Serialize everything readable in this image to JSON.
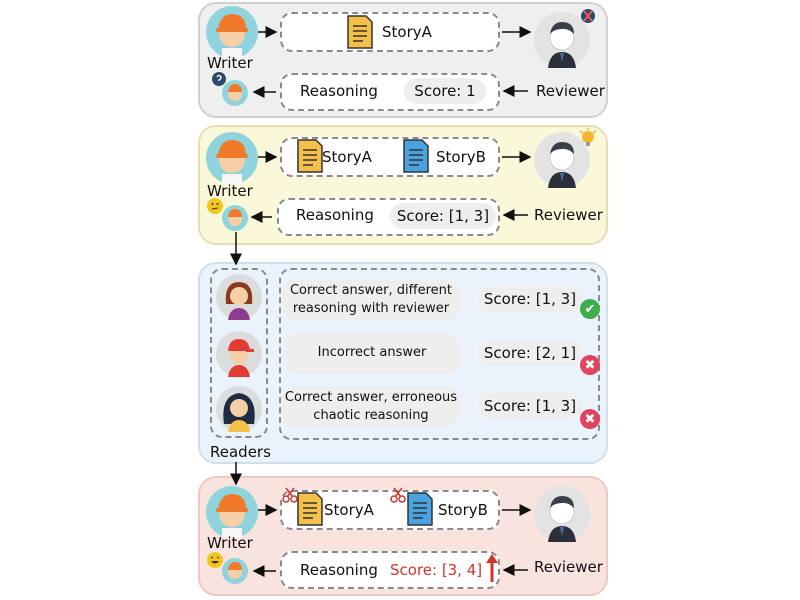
{
  "panel1": {
    "writer": "Writer",
    "reviewer": "Reviewer",
    "story_a": "StoryA",
    "reasoning": "Reasoning",
    "score": "Score: 1"
  },
  "panel2": {
    "writer": "Writer",
    "reviewer": "Reviewer",
    "story_a": "StoryA",
    "story_b": "StoryB",
    "reasoning": "Reasoning",
    "score": "Score: [1, 3]"
  },
  "panel3": {
    "readers": "Readers",
    "rows": [
      {
        "text_line1": "Correct answer, different",
        "text_line2": "reasoning with reviewer",
        "score": "Score: [1, 3]",
        "status": "correct",
        "mark": "✔"
      },
      {
        "text_line1": "Incorrect answer",
        "text_line2": "",
        "score": "Score: [2, 1]",
        "status": "incorrect",
        "mark": "✖"
      },
      {
        "text_line1": "Correct answer, erroneous",
        "text_line2": "chaotic reasoning",
        "score": "Score: [1, 3]",
        "status": "incorrect",
        "mark": "✖"
      }
    ]
  },
  "panel4": {
    "writer": "Writer",
    "reviewer": "Reviewer",
    "story_a": "StoryA",
    "story_b": "StoryB",
    "reasoning": "Reasoning",
    "score": "Score: [3, 4]"
  },
  "colors": {
    "panel1_bg": "#efefef",
    "panel2_bg": "#fbf8d9",
    "panel3_bg": "#eaf3fb",
    "panel4_bg": "#f8e3df",
    "score_highlight": "#d6322b",
    "correct": "#3fae4a",
    "incorrect": "#e0445f"
  },
  "icons": [
    "writer-avatar",
    "reviewer-avatar",
    "document-icon",
    "scissors-icon",
    "reader-avatar",
    "check-icon",
    "cross-icon",
    "question-bubble-icon",
    "thinking-emoji-icon",
    "laughing-emoji-icon",
    "lightbulb-icon",
    "up-arrow-icon"
  ]
}
